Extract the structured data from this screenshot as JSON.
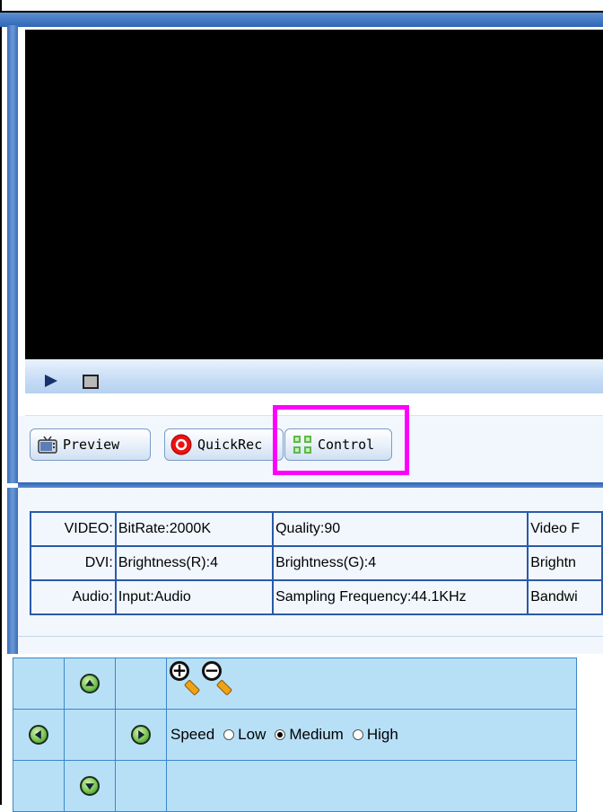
{
  "toolbar": {
    "preview_label": "Preview",
    "quickrec_label": "QuickRec",
    "control_label": "Control"
  },
  "info_table": {
    "rows": [
      {
        "label": "VIDEO:",
        "c1": "BitRate:2000K",
        "c2": "Quality:90",
        "c3": "Video F"
      },
      {
        "label": "DVI:",
        "c1": "Brightness(R):4",
        "c2": "Brightness(G):4",
        "c3": "Brightn"
      },
      {
        "label": "Audio:",
        "c1": "Input:Audio",
        "c2": "Sampling Frequency:44.1KHz",
        "c3": "Bandwi"
      }
    ]
  },
  "ptz": {
    "speed_label": "Speed",
    "options": [
      "Low",
      "Medium",
      "High"
    ],
    "selected": "Medium"
  },
  "colors": {
    "highlight": "#ff00ff",
    "frame_blue": "#2f64b2",
    "ptz_bg": "#b7e0f7"
  }
}
